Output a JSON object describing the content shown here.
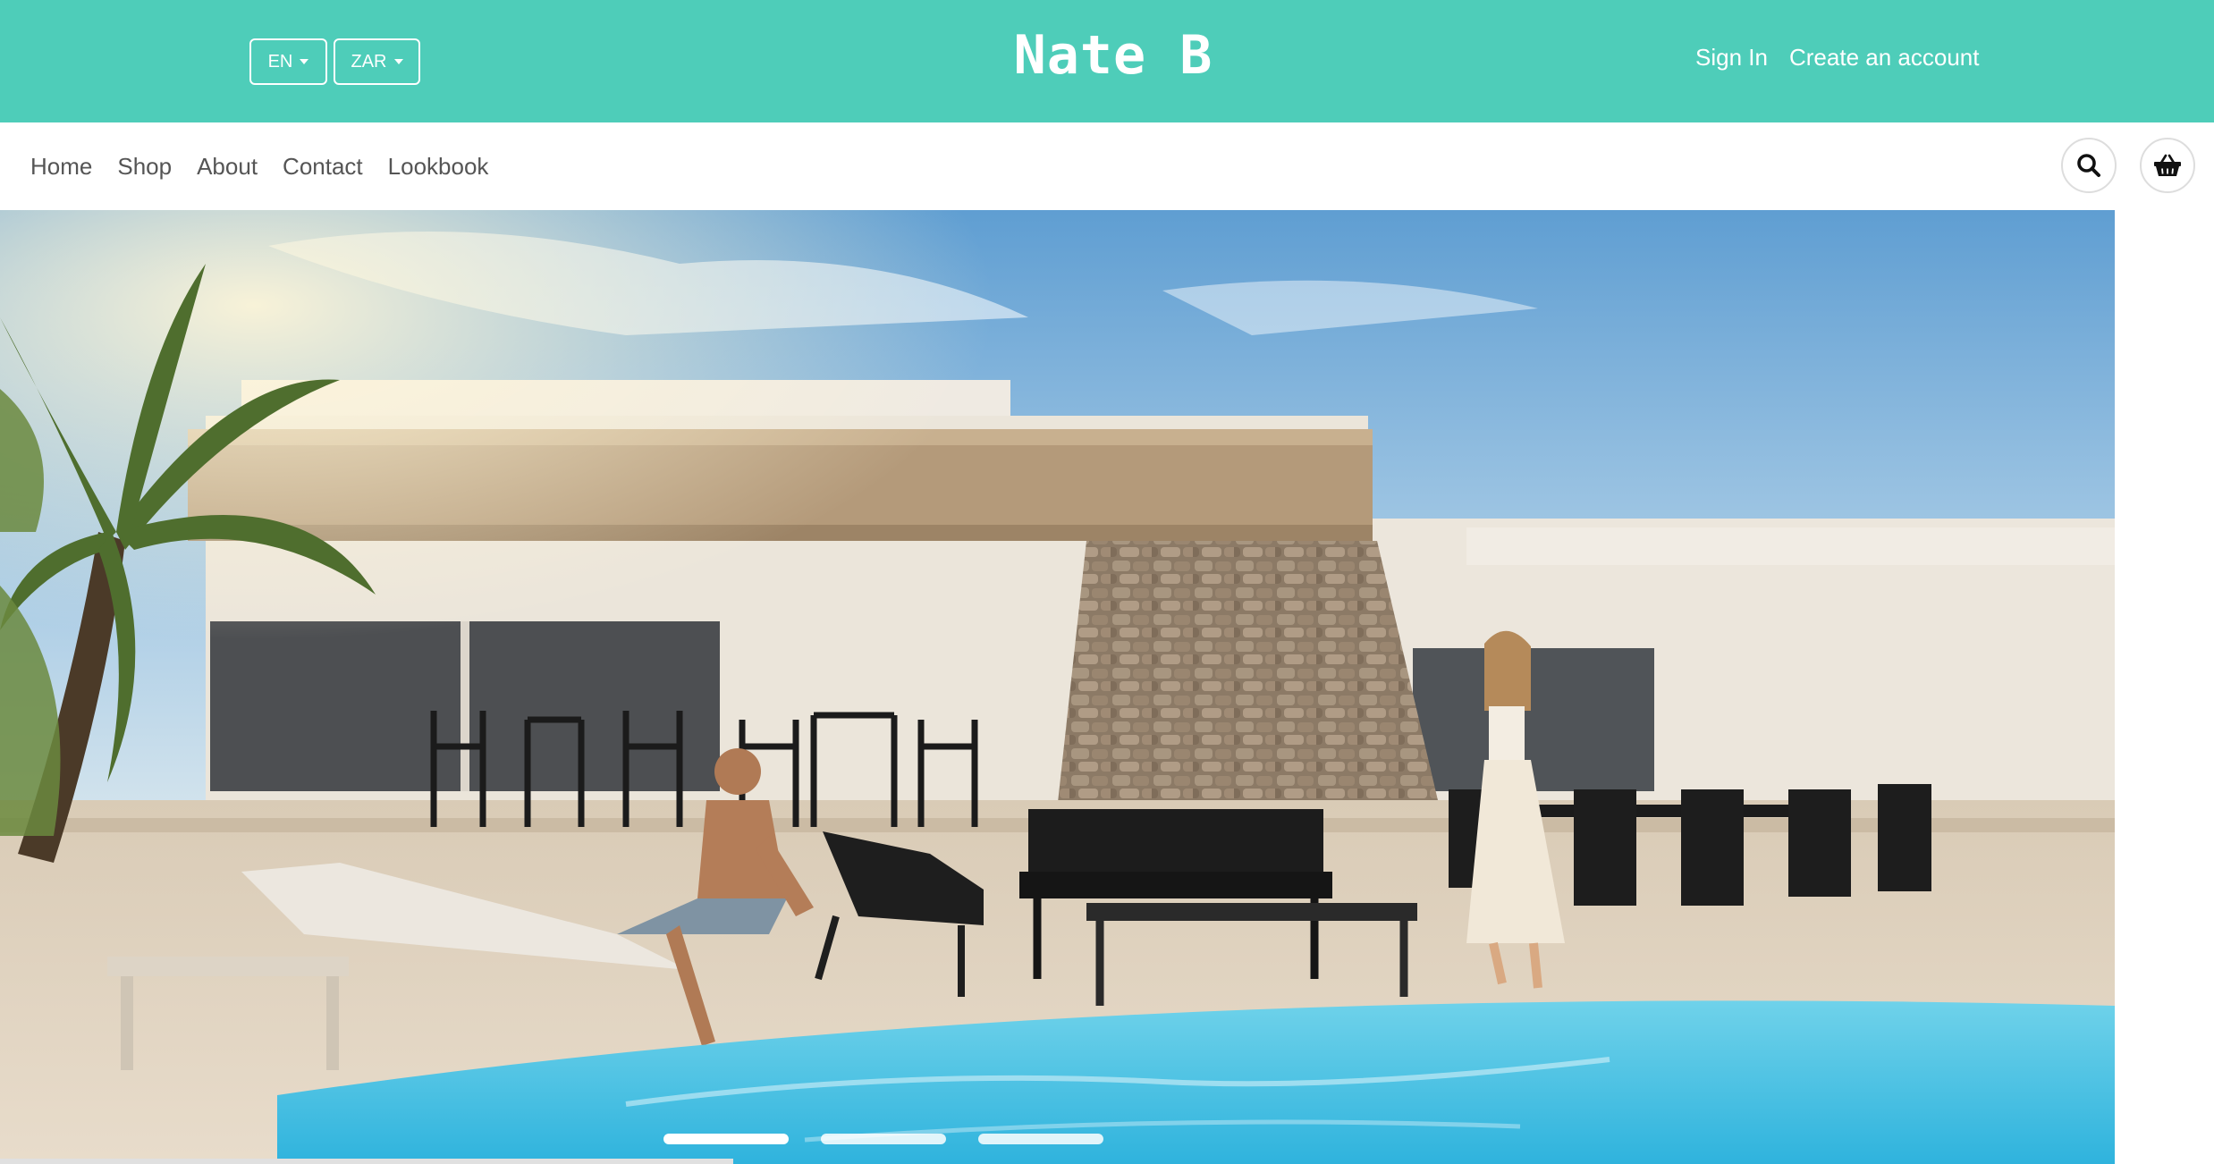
{
  "topbar": {
    "language": "EN",
    "currency": "ZAR",
    "logo": "Nate B",
    "sign_in": "Sign In",
    "create_account": "Create an account",
    "bg_color": "#4ecdb9"
  },
  "nav": {
    "items": [
      {
        "label": "Home"
      },
      {
        "label": "Shop"
      },
      {
        "label": "About"
      },
      {
        "label": "Contact"
      },
      {
        "label": "Lookbook"
      }
    ],
    "search_icon": "search-icon",
    "basket_icon": "basket-icon"
  },
  "hero": {
    "slides": 3,
    "active_slide": 1
  }
}
